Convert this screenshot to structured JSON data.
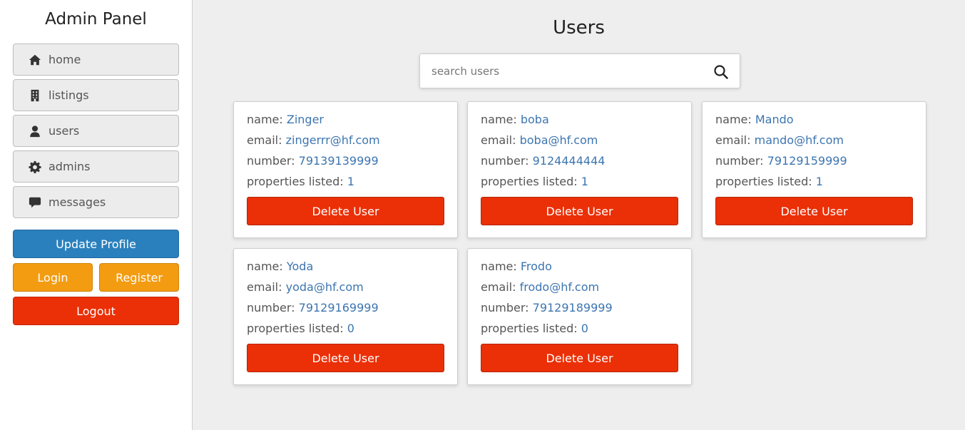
{
  "sidebar": {
    "title": "Admin Panel",
    "nav": [
      {
        "label": "home",
        "icon": "home-icon"
      },
      {
        "label": "listings",
        "icon": "building-icon"
      },
      {
        "label": "users",
        "icon": "user-icon"
      },
      {
        "label": "admins",
        "icon": "gear-icon"
      },
      {
        "label": "messages",
        "icon": "comment-icon"
      }
    ],
    "update_profile": "Update Profile",
    "login": "Login",
    "register": "Register",
    "logout": "Logout"
  },
  "main": {
    "title": "Users",
    "search_placeholder": "search users",
    "labels": {
      "name": "name: ",
      "email": "email: ",
      "number": "number: ",
      "properties": "properties listed: "
    },
    "delete_label": "Delete User",
    "users": [
      {
        "name": "Zinger",
        "email": "zingerrr@hf.com",
        "number": "79139139999",
        "properties": "1"
      },
      {
        "name": "boba",
        "email": "boba@hf.com",
        "number": "9124444444",
        "properties": "1"
      },
      {
        "name": "Mando",
        "email": "mando@hf.com",
        "number": "79129159999",
        "properties": "1"
      },
      {
        "name": "Yoda",
        "email": "yoda@hf.com",
        "number": "79129169999",
        "properties": "0"
      },
      {
        "name": "Frodo",
        "email": "frodo@hf.com",
        "number": "79129189999",
        "properties": "0"
      }
    ]
  },
  "colors": {
    "primary": "#2a80bd",
    "warning": "#f39c12",
    "danger": "#eb2f06",
    "link": "#3d75b0"
  }
}
